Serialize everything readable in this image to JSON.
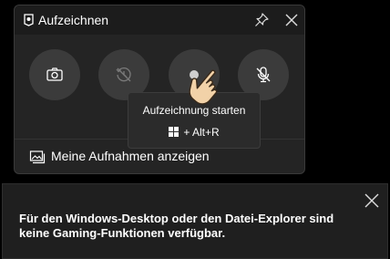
{
  "capture_panel": {
    "title": "Aufzeichnen",
    "header_icon": "camera-mark-icon",
    "pin_icon": "pin-icon",
    "close_icon": "close-icon",
    "buttons": [
      {
        "name": "screenshot-button",
        "icon": "camera-icon"
      },
      {
        "name": "record-last-button",
        "icon": "history-disabled-icon"
      },
      {
        "name": "start-recording-button",
        "icon": "record-dot-icon"
      },
      {
        "name": "mic-toggle-button",
        "icon": "mic-off-icon"
      }
    ],
    "captures_link": {
      "icon": "gallery-icon",
      "label": "Meine Aufnahmen anzeigen"
    }
  },
  "tooltip": {
    "title": "Aufzeichnung starten",
    "shortcut_icon": "windows-icon",
    "shortcut": "+ Alt+R"
  },
  "notice": {
    "text": "Für den Windows-Desktop oder den Datei-Explorer sind keine Gaming-Funktionen verfügbar.",
    "close_icon": "close-icon"
  },
  "colors": {
    "panel_bg": "#242424",
    "header_bg": "#1c1c1c",
    "button_bg": "#3b3b3b",
    "tooltip_bg": "#2b2b2b",
    "notice_bg": "#1f1f1f"
  }
}
